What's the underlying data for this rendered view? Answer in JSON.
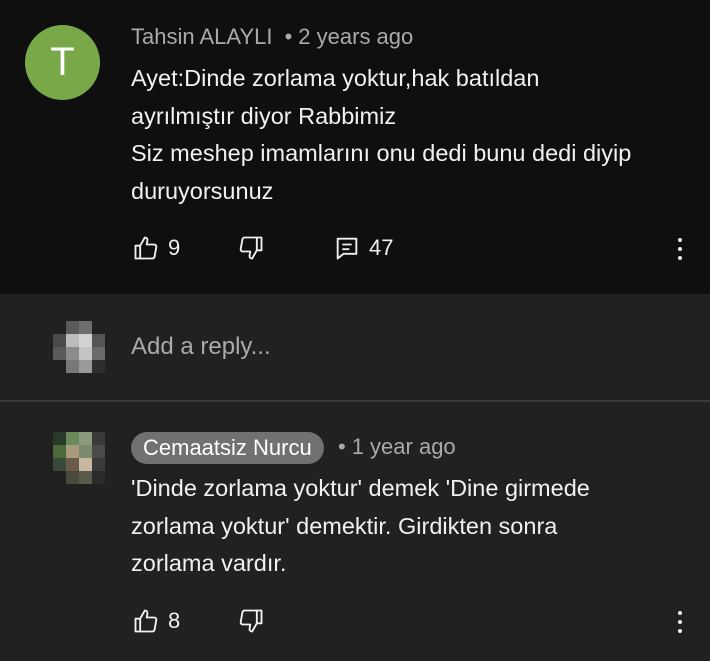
{
  "top_comment": {
    "avatar_letter": "T",
    "avatar_color": "#78a848",
    "author": "Tahsin ALAYLI",
    "separator": "•",
    "time": "2 years ago",
    "lines": [
      "Ayet:Dinde zorlama yoktur,hak batıldan",
      "ayrılmıştır diyor Rabbimiz",
      "Siz meshep imamlarını onu dedi bunu dedi diyip",
      "duruyorsunuz"
    ],
    "like_count": "9",
    "reply_count": "47"
  },
  "reply_box": {
    "placeholder": "Add a reply..."
  },
  "reply_comment": {
    "author": "Cemaatsiz Nurcu",
    "separator": "•",
    "time": "1 year ago",
    "lines": [
      "'Dinde zorlama yoktur' demek 'Dine girmede",
      "zorlama yoktur' demektir. Girdikten sonra",
      "zorlama vardır."
    ],
    "like_count": "8"
  },
  "colors": {
    "background": "#0f0f0f",
    "panel": "#212121",
    "text": "#f1f1f1",
    "secondary_text": "#aaaaaa",
    "chip": "#717171"
  },
  "icons": [
    "like-icon",
    "dislike-icon",
    "reply-icon",
    "more-vert-icon"
  ]
}
